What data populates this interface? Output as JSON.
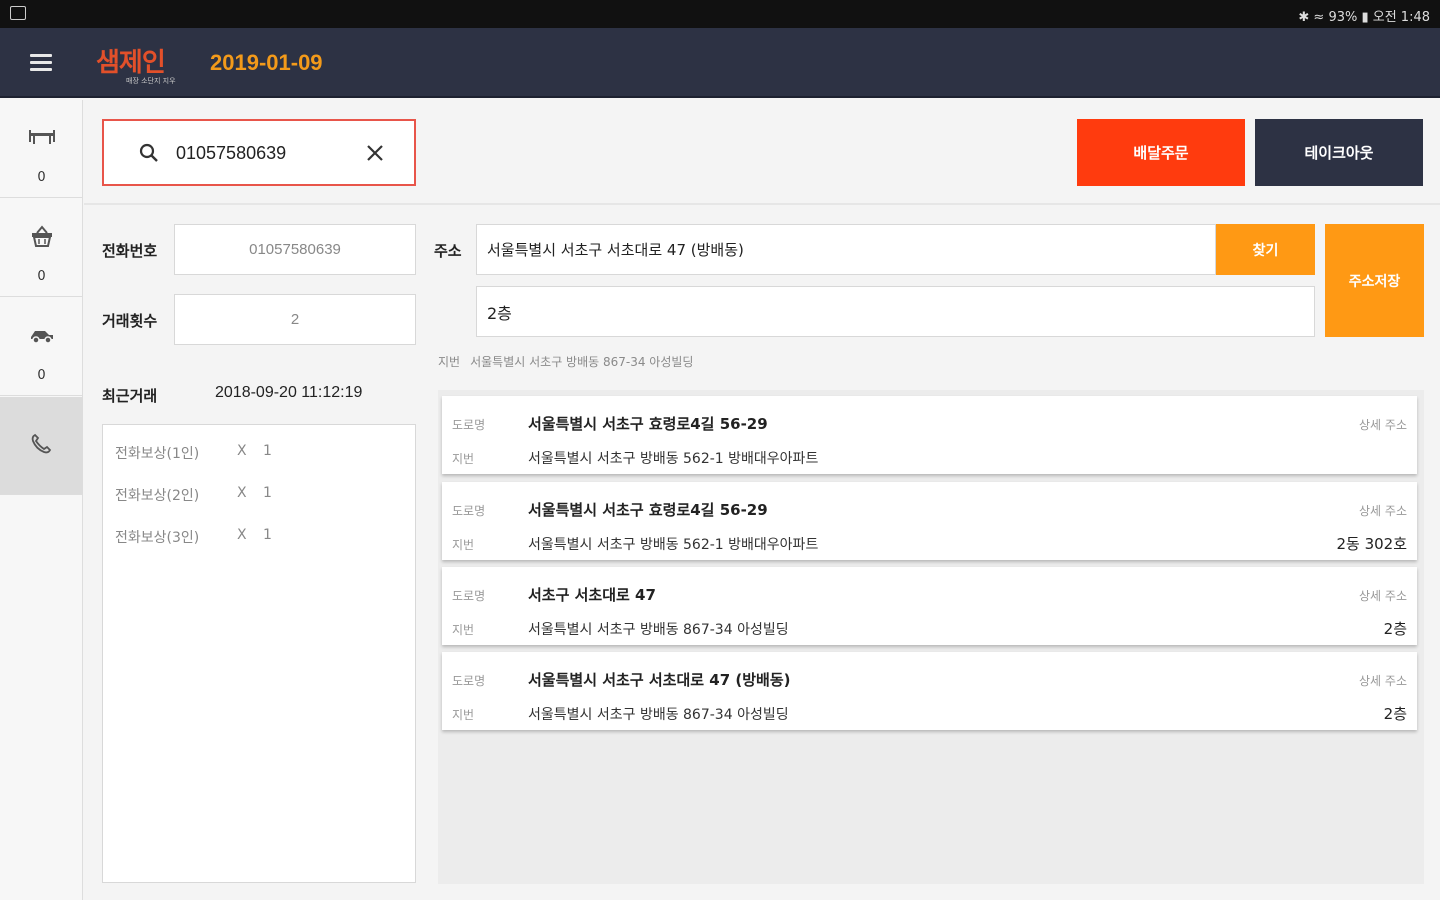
{
  "status_bar": {
    "right_text": "✱ ≈ 93% ▮ 오전 1:48"
  },
  "app": {
    "logo_text": "샘제인",
    "logo_sub": "매장 소단지 지우",
    "date": "2019-01-09"
  },
  "sidebar": {
    "items": [
      {
        "icon": "table-icon",
        "count": "0"
      },
      {
        "icon": "basket-icon",
        "count": "0"
      },
      {
        "icon": "delivery-icon",
        "count": "0"
      },
      {
        "icon": "phone-icon",
        "count": ""
      }
    ]
  },
  "search": {
    "value": "01057580639"
  },
  "buttons": {
    "delivery": "배달주문",
    "takeout": "테이크아웃",
    "find": "찾기",
    "save_address": "주소저장"
  },
  "customer": {
    "phone_label": "전화번호",
    "phone": "01057580639",
    "count_label": "거래횟수",
    "count": "2",
    "last_label": "최근거래",
    "last": "2018-09-20 11:12:19"
  },
  "history": [
    {
      "name": "전화보상(1인)",
      "x": "X",
      "qty": "1"
    },
    {
      "name": "전화보상(2인)",
      "x": "X",
      "qty": "1"
    },
    {
      "name": "전화보상(3인)",
      "x": "X",
      "qty": "1"
    }
  ],
  "address": {
    "label": "주소",
    "value": "서울특별시 서초구 서초대로 47 (방배동)",
    "detail": "2층",
    "jibun_label": "지번",
    "jibun": "서울특별시 서초구 방배동 867-34 아성빌딩"
  },
  "address_list": [
    {
      "road_label": "도로명",
      "road": "서울특별시 서초구 효령로4길 56-29",
      "jibun_label": "지번",
      "jibun": "서울특별시 서초구 방배동 562-1 방배대우아파트",
      "detail_label": "상세 주소",
      "detail": ""
    },
    {
      "road_label": "도로명",
      "road": "서울특별시 서초구 효령로4길 56-29",
      "jibun_label": "지번",
      "jibun": "서울특별시 서초구 방배동 562-1 방배대우아파트",
      "detail_label": "상세 주소",
      "detail": "2동 302호"
    },
    {
      "road_label": "도로명",
      "road": "서초구 서초대로 47",
      "jibun_label": "지번",
      "jibun": "서울특별시 서초구 방배동 867-34 아성빌딩",
      "detail_label": "상세 주소",
      "detail": "2층"
    },
    {
      "road_label": "도로명",
      "road": "서울특별시 서초구 서초대로 47 (방배동)",
      "jibun_label": "지번",
      "jibun": "서울특별시 서초구 방배동 867-34 아성빌딩",
      "detail_label": "상세 주소",
      "detail": "2층"
    }
  ],
  "colors": {
    "appbar": "#2d3244",
    "accent_orange": "#ff9914",
    "delivery_red": "#ff3b0e",
    "date_orange": "#f39a1a",
    "search_border": "#e8554a"
  }
}
